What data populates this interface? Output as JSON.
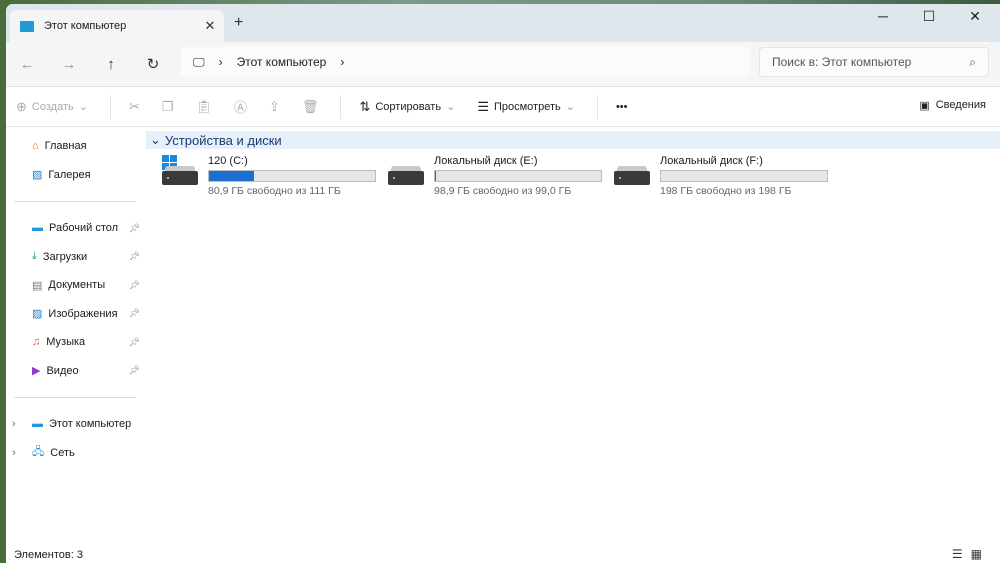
{
  "tab": {
    "title": "Этот компьютер",
    "close": "✕",
    "new": "+"
  },
  "window_controls": {
    "minimize": "─",
    "maximize": "☐",
    "close": "✕"
  },
  "nav": {
    "back": "←",
    "forward": "→",
    "up": "↑",
    "refresh": "↻"
  },
  "address": {
    "crumb": "Этот компьютер"
  },
  "search": {
    "placeholder": "Поиск в: Этот компьютер"
  },
  "toolbar": {
    "create": "Создать",
    "sort": "Сортировать",
    "view": "Просмотреть",
    "more": "•••",
    "details": "Сведения"
  },
  "sidebar": {
    "top": [
      {
        "label": "Главная"
      },
      {
        "label": "Галерея"
      }
    ],
    "pinned": [
      {
        "label": "Рабочий стол"
      },
      {
        "label": "Загрузки"
      },
      {
        "label": "Документы"
      },
      {
        "label": "Изображения"
      },
      {
        "label": "Музыка"
      },
      {
        "label": "Видео"
      }
    ],
    "tree": [
      {
        "label": "Этот компьютер"
      },
      {
        "label": "Сеть"
      }
    ]
  },
  "group": {
    "title": "Устройства и диски"
  },
  "drives": [
    {
      "name": "120 (C:)",
      "free": "80,9 ГБ свободно из 111 ГБ",
      "used_fraction": 0.27,
      "system": true
    },
    {
      "name": "Локальный диск (E:)",
      "free": "98,9 ГБ свободно из 99,0 ГБ",
      "used_fraction": 0.001
    },
    {
      "name": "Локальный диск (F:)",
      "free": "198 ГБ свободно из 198 ГБ",
      "used_fraction": 0.0
    }
  ],
  "status": {
    "count": "Элементов: 3"
  },
  "colors": {
    "accent": "#1a6fcf",
    "group_bg": "#e5f0fa"
  }
}
